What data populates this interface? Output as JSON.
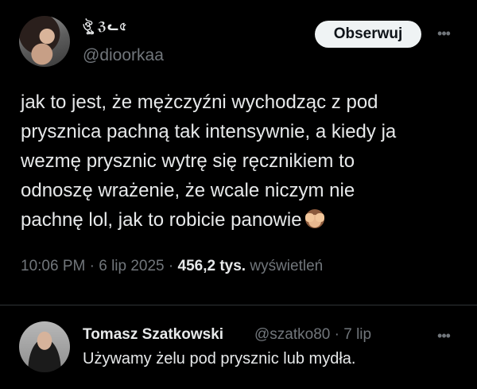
{
  "tweet": {
    "author": {
      "display_name": "ঔৣ ℨᓚ৫",
      "handle": "@dioorkaa"
    },
    "follow_label": "Obserwuj",
    "more_label": "•••",
    "text_lines": [
      "jak to jest, że mężczyźni wychodząc z pod",
      "prysznica pachną tak intensywnie, a kiedy ja",
      "wezmę prysznic wytrę się ręcznikiem to",
      "odnoszę wrażenie, że wcale niczym nie",
      "pachnę lol, jak to robicie panowie"
    ],
    "emoji": "see-no-evil-monkey",
    "time": "10:06 PM",
    "separator": "·",
    "date": "6 lip 2025",
    "views_count": "456,2 tys.",
    "views_label": "wyświetleń"
  },
  "reply": {
    "author_name": "Tomasz Szatkowski",
    "handle_and_time": "@szatko80 · 7 lip",
    "more_label": "•••",
    "text": "Używamy żelu pod prysznic lub mydła."
  },
  "colors": {
    "background": "#000000",
    "primary_text": "#e7e9ea",
    "secondary_text": "#71767b",
    "divider": "#2f3336",
    "follow_button_bg": "#eff3f4"
  }
}
